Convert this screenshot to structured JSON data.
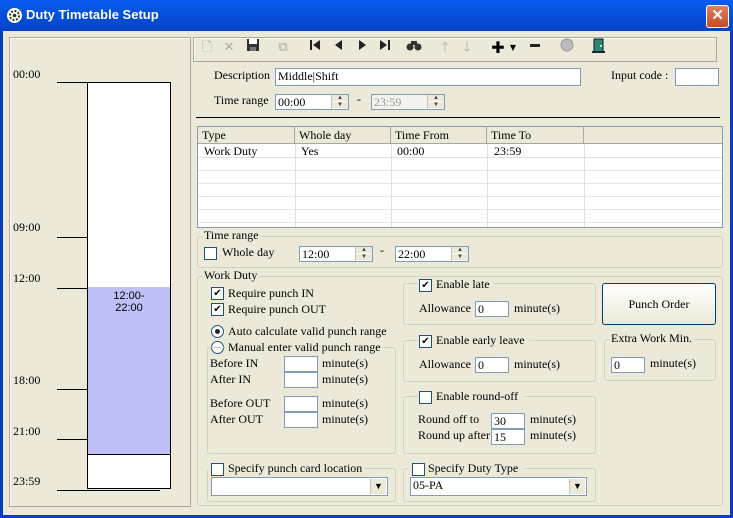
{
  "window": {
    "title": "Duty Timetable Setup",
    "close_glyph": "✕"
  },
  "timeline": {
    "labels": [
      "00:00",
      "09:00",
      "12:00",
      "18:00",
      "21:00",
      "23:59"
    ],
    "block_label_line1": "12:00-",
    "block_label_line2": "22:00",
    "block_color": "#c0c0f8"
  },
  "toolbar": {
    "icons": [
      "new-icon",
      "delete-icon",
      "save-icon",
      "copy-icon",
      "first-record-icon",
      "prev-record-icon",
      "next-record-icon",
      "last-record-icon",
      "find-icon",
      "move-up-icon",
      "move-down-icon",
      "add-row-icon",
      "remove-row-icon",
      "disabled-circle-icon",
      "exit-door-icon"
    ]
  },
  "header": {
    "description_label": "Description",
    "description_value": "Middle|Shift",
    "input_code_label": "Input code :",
    "input_code_value": "",
    "time_range_label": "Time range",
    "time_from": "00:00",
    "time_sep": "-",
    "time_to": "23:59"
  },
  "grid": {
    "columns": [
      "Type",
      "Whole day",
      "Time From",
      "Time To"
    ],
    "rows": [
      {
        "type": "Work Duty",
        "whole_day": "Yes",
        "from": "00:00",
        "to": "23:59"
      }
    ]
  },
  "time_range_group": {
    "label": "Time range",
    "whole_day_label": "Whole day",
    "from": "12:00",
    "sep": "-",
    "to": "22:00"
  },
  "work_duty": {
    "label": "Work Duty",
    "require_in": "Require punch IN",
    "require_out": "Require punch OUT",
    "auto_calc": "Auto calculate valid punch range",
    "manual": "Manual enter valid punch range",
    "before_in": "Before IN",
    "after_in": "After IN",
    "before_out": "Before OUT",
    "after_out": "After OUT",
    "minutes": "minute(s)"
  },
  "late": {
    "label": "Enable late",
    "allowance_label": "Allowance",
    "allowance": "0",
    "unit": "minute(s)"
  },
  "early": {
    "label": "Enable early leave",
    "allowance_label": "Allowance",
    "allowance": "0",
    "unit": "minute(s)"
  },
  "roundoff": {
    "label": "Enable round-off",
    "off_label": "Round off to",
    "off_value": "30",
    "up_label": "Round up after",
    "up_value": "15",
    "unit": "minute(s)"
  },
  "punch_order_label": "Punch Order",
  "extra": {
    "label": "Extra Work Min.",
    "value": "0",
    "unit": "minute(s)"
  },
  "location": {
    "label": "Specify punch card location",
    "value": ""
  },
  "duty_type": {
    "label": "Specify Duty Type",
    "value": "05-PA"
  }
}
